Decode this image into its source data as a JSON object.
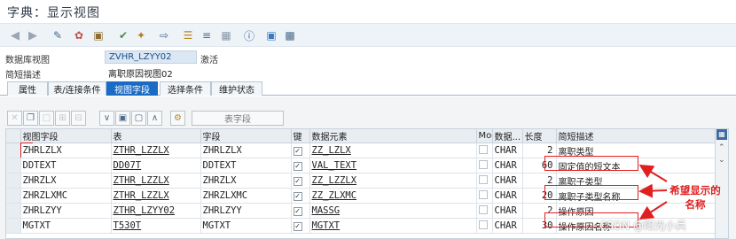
{
  "window": {
    "title": "字典：显示视图"
  },
  "toolbar": {
    "icons": [
      "back-icon",
      "forward-icon",
      "display-change-icon",
      "active-inactive-icon",
      "other-object-icon",
      "check-icon",
      "activate-icon",
      "where-used-icon",
      "hierarchy-icon",
      "object-list-icon",
      "display-object-list-icon",
      "information-icon",
      "tree-icon",
      "table-view-icon"
    ]
  },
  "header": {
    "view_label": "数据库视图",
    "view_name": "ZVHR_LZYY02",
    "view_status": "激活",
    "short_desc_label": "简短描述",
    "short_desc_value": "离职原因视图02"
  },
  "tabs": [
    {
      "label": "属性",
      "active": false
    },
    {
      "label": "表/连接条件",
      "active": false
    },
    {
      "label": "视图字段",
      "active": true
    },
    {
      "label": "选择条件",
      "active": false
    },
    {
      "label": "维护状态",
      "active": false
    }
  ],
  "subtoolbar": {
    "field_button": "表字段"
  },
  "grid": {
    "columns": [
      "视图字段",
      "表",
      "字段",
      "键",
      "数据元素",
      "Mod",
      "数据...",
      "长度",
      "简短描述"
    ],
    "rows": [
      {
        "view_field": "ZHRLZLX",
        "table": "ZTHR_LZZLX",
        "field": "ZHRLZLX",
        "key": true,
        "data_element": "ZZ_LZLX",
        "mod": false,
        "type": "CHAR",
        "length": "2",
        "desc": "离职类型"
      },
      {
        "view_field": "DDTEXT",
        "table": "DD07T",
        "field": "DDTEXT",
        "key": true,
        "data_element": "VAL_TEXT",
        "mod": false,
        "type": "CHAR",
        "length": "60",
        "desc": "固定值的短文本"
      },
      {
        "view_field": "ZHRZLX",
        "table": "ZTHR_LZZLX",
        "field": "ZHRZLX",
        "key": true,
        "data_element": "ZZ_LZZLX",
        "mod": false,
        "type": "CHAR",
        "length": "2",
        "desc": "离职子类型"
      },
      {
        "view_field": "ZHRZLXMC",
        "table": "ZTHR_LZZLX",
        "field": "ZHRZLXMC",
        "key": true,
        "data_element": "ZZ_ZLXMC",
        "mod": false,
        "type": "CHAR",
        "length": "20",
        "desc": "离职子类型名称"
      },
      {
        "view_field": "ZHRLZYY",
        "table": "ZTHR_LZYY02",
        "field": "ZHRLZYY",
        "key": true,
        "data_element": "MASSG",
        "mod": false,
        "type": "CHAR",
        "length": "2",
        "desc": "操作原因"
      },
      {
        "view_field": "MGTXT",
        "table": "T530T",
        "field": "MGTXT",
        "key": true,
        "data_element": "MGTXT",
        "mod": false,
        "type": "CHAR",
        "length": "30",
        "desc": "操作原因名称"
      }
    ]
  },
  "annotation": {
    "line1": "希望显示的",
    "line2": "名称"
  },
  "watermark": "CSDN @阳光小兵",
  "colors": {
    "accent": "#1a6bc4",
    "highlight": "#e02020"
  }
}
